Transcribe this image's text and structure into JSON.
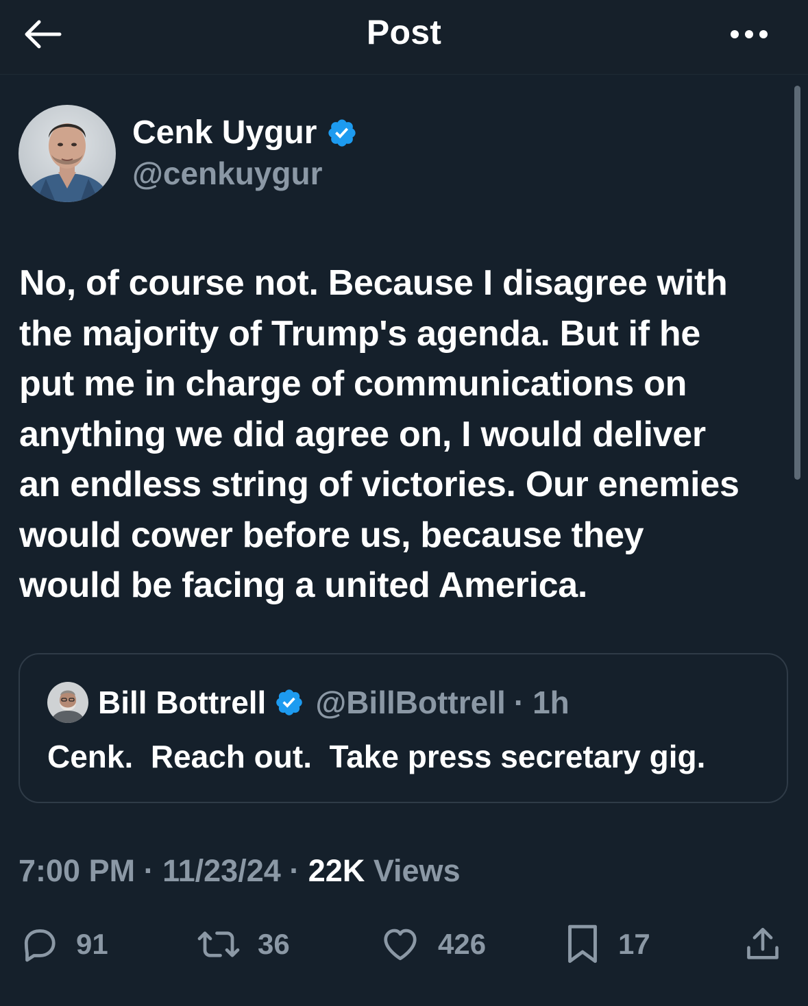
{
  "header": {
    "title": "Post",
    "back_icon": "arrow-left-icon",
    "more_icon": "more-horizontal-icon"
  },
  "author": {
    "name": "Cenk Uygur",
    "handle": "@cenkuygur",
    "verified": true
  },
  "post": {
    "lines": [
      "No, of course not. Because I disagree with",
      "the majority of Trump's agenda. But if he",
      "put me in charge of communications on",
      "anything we did agree on, I would deliver",
      "an endless string of victories. Our enemies",
      "would cower before us, because they",
      "would be facing a united America."
    ]
  },
  "quote": {
    "name": "Bill Bottrell",
    "handle": "@BillBottrell",
    "separator": "·",
    "time": "1h",
    "text": "Cenk.  Reach out.  Take press secretary gig."
  },
  "meta": {
    "time": "7:00 PM",
    "sep1": " · ",
    "date": "11/23/24",
    "sep2": " · ",
    "views_count": "22K",
    "views_label": " Views"
  },
  "actions": {
    "reply": "91",
    "retweet": "36",
    "like": "426",
    "bookmark": "17"
  },
  "colors": {
    "background": "#15202b",
    "text": "#ffffff",
    "secondary": "#8b98a5",
    "verified": "#1d9bf0",
    "border": "#2f3b47"
  }
}
